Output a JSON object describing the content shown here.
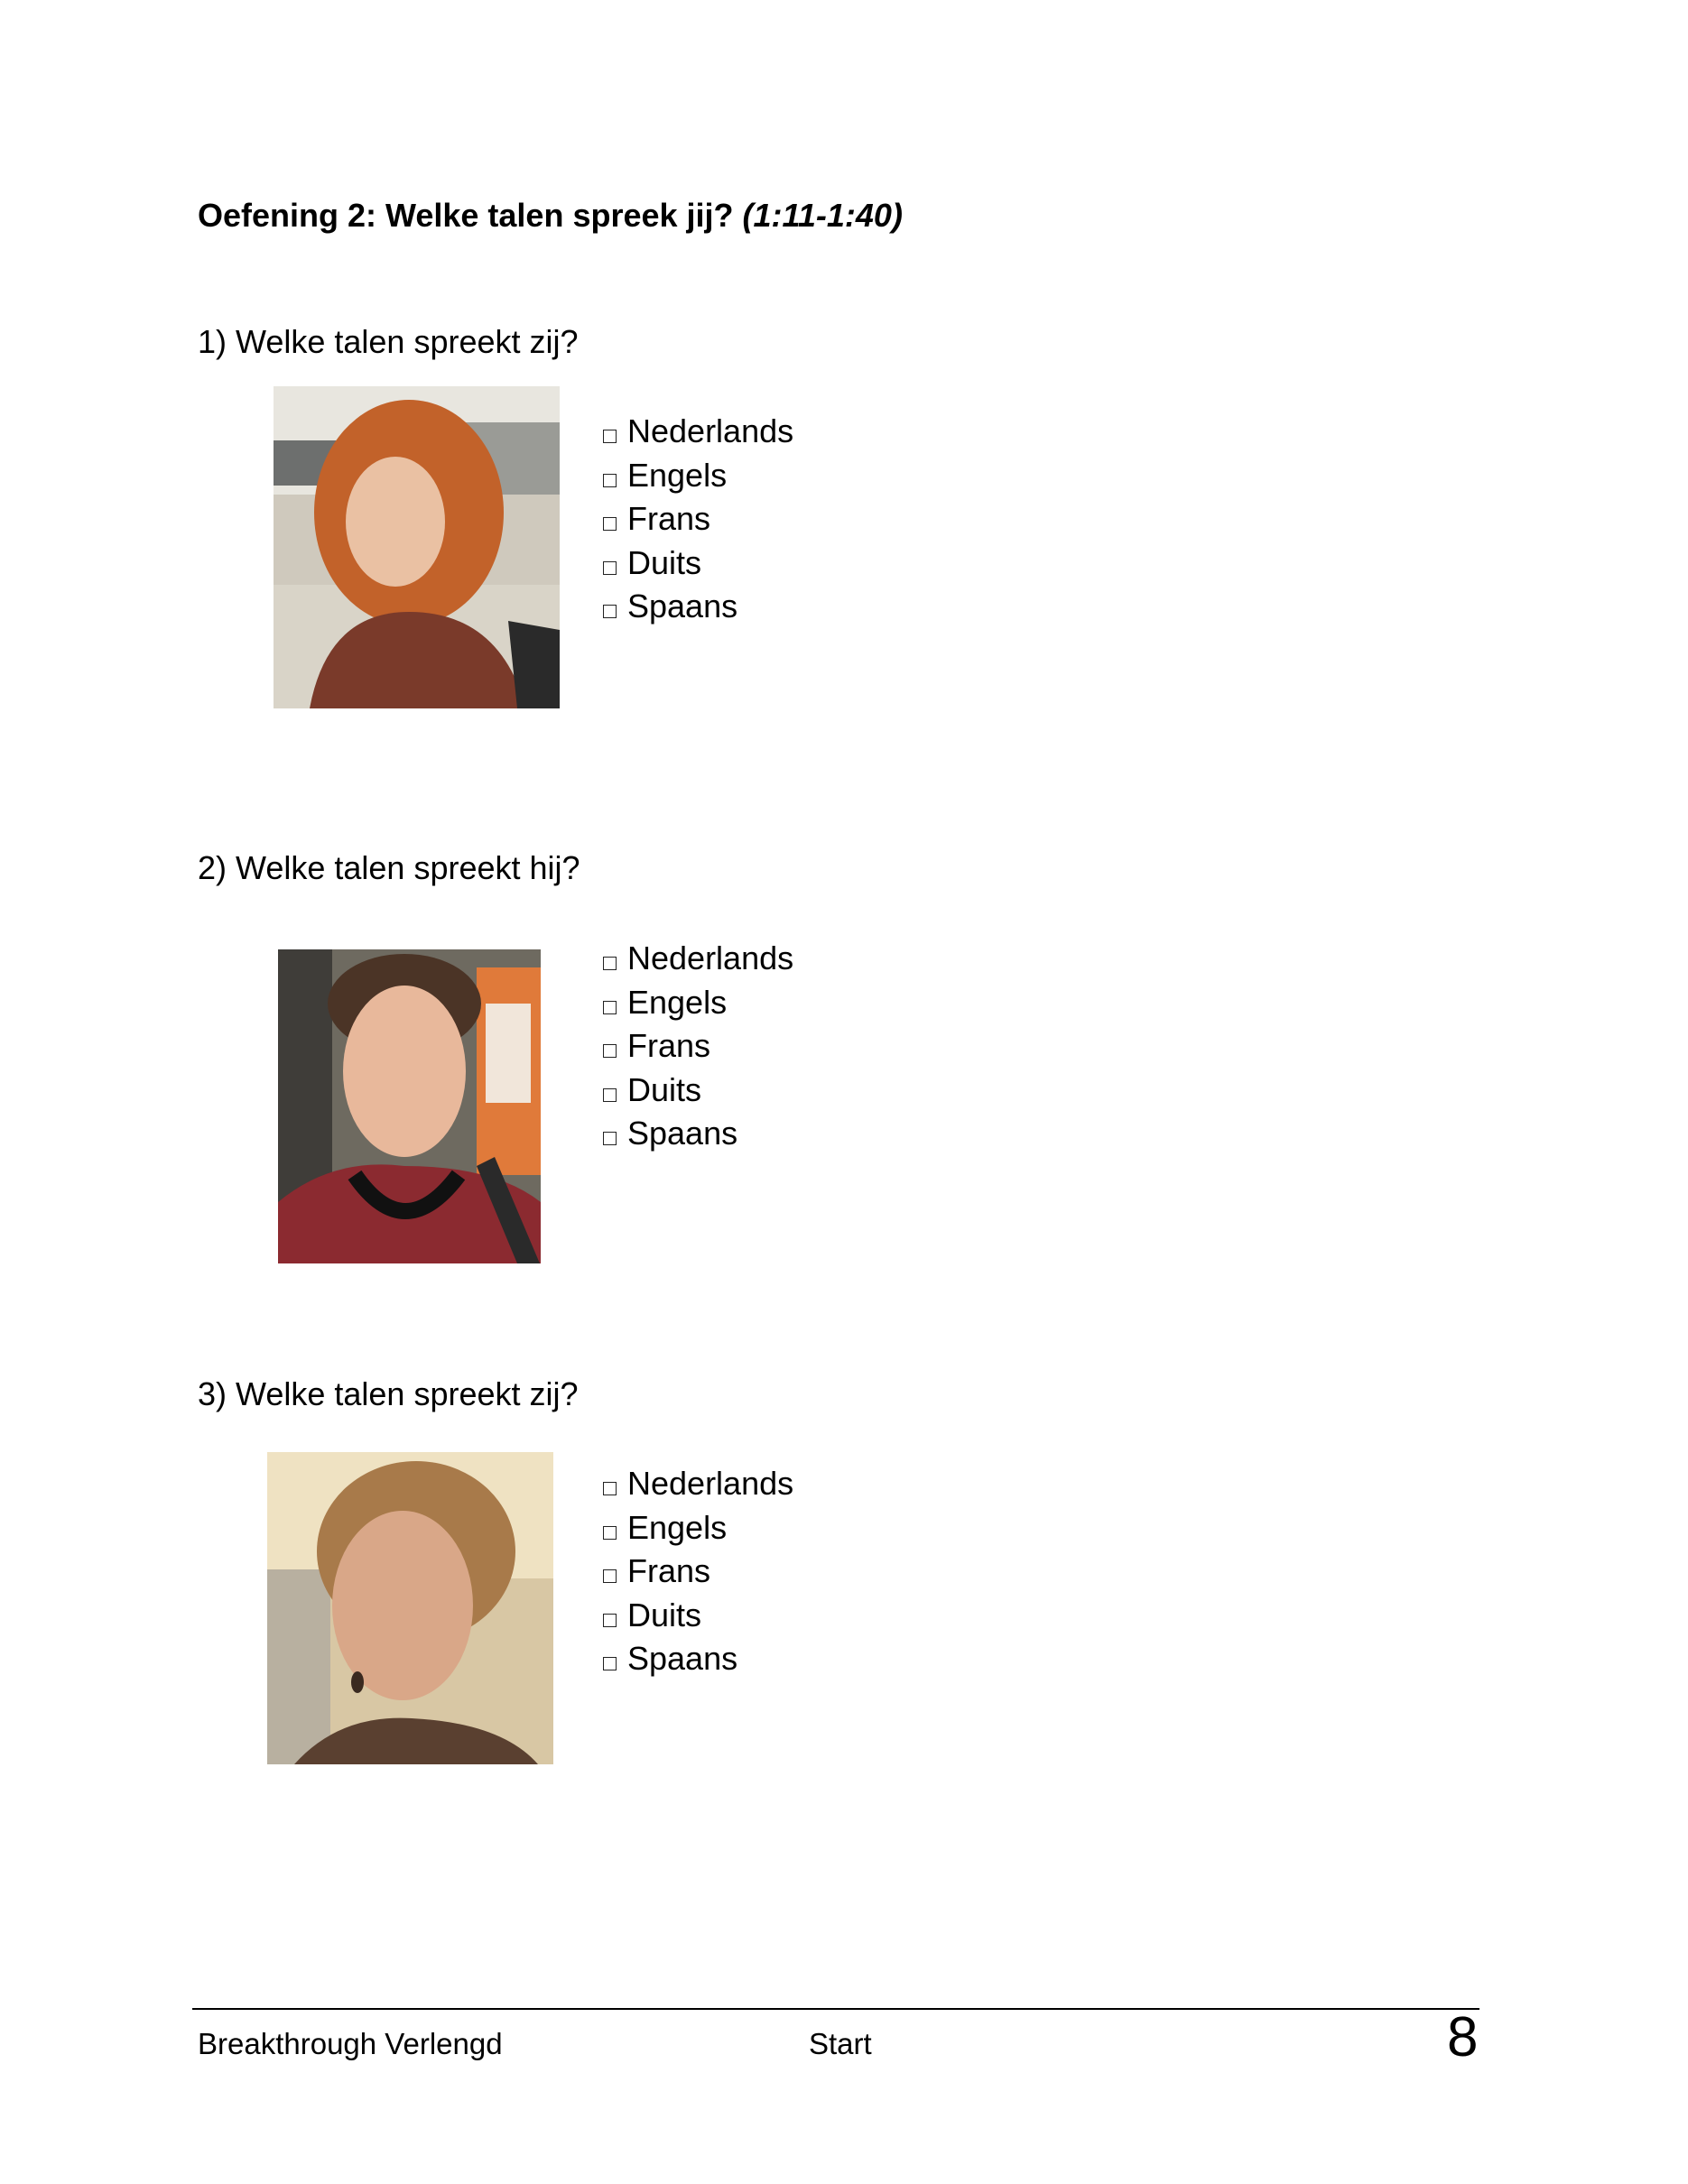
{
  "header": {
    "title": "Oefening 2: Welke talen spreek jij?",
    "timecode": "(1:11-1:40)"
  },
  "questions": [
    {
      "text": "1) Welke talen spreekt zij?",
      "photo_icon": "woman-red-curly-hair-photo",
      "options": [
        "Nederlands",
        "Engels",
        "Frans",
        "Duits",
        "Spaans"
      ]
    },
    {
      "text": "2) Welke talen spreekt hij?",
      "photo_icon": "young-man-headphones-photo",
      "options": [
        "Nederlands",
        "Engels",
        "Frans",
        "Duits",
        "Spaans"
      ]
    },
    {
      "text": "3) Welke talen spreekt zij?",
      "photo_icon": "woman-short-hair-photo",
      "options": [
        "Nederlands",
        "Engels",
        "Frans",
        "Duits",
        "Spaans"
      ]
    }
  ],
  "footer": {
    "left": "Breakthrough Verlengd",
    "center": "Start",
    "page_number": "8"
  }
}
